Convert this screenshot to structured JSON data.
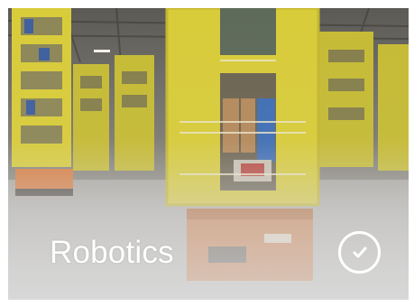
{
  "tile": {
    "title": "Robotics",
    "selected": true,
    "image_icon": "warehouse-robotics-photo",
    "check_icon": "check-circle-icon"
  },
  "colors": {
    "title_text": "#ffffff",
    "pod_yellow": "#d8cc3a",
    "robot_orange": "#d9793a",
    "overlay_light": "#dcdcdc"
  }
}
